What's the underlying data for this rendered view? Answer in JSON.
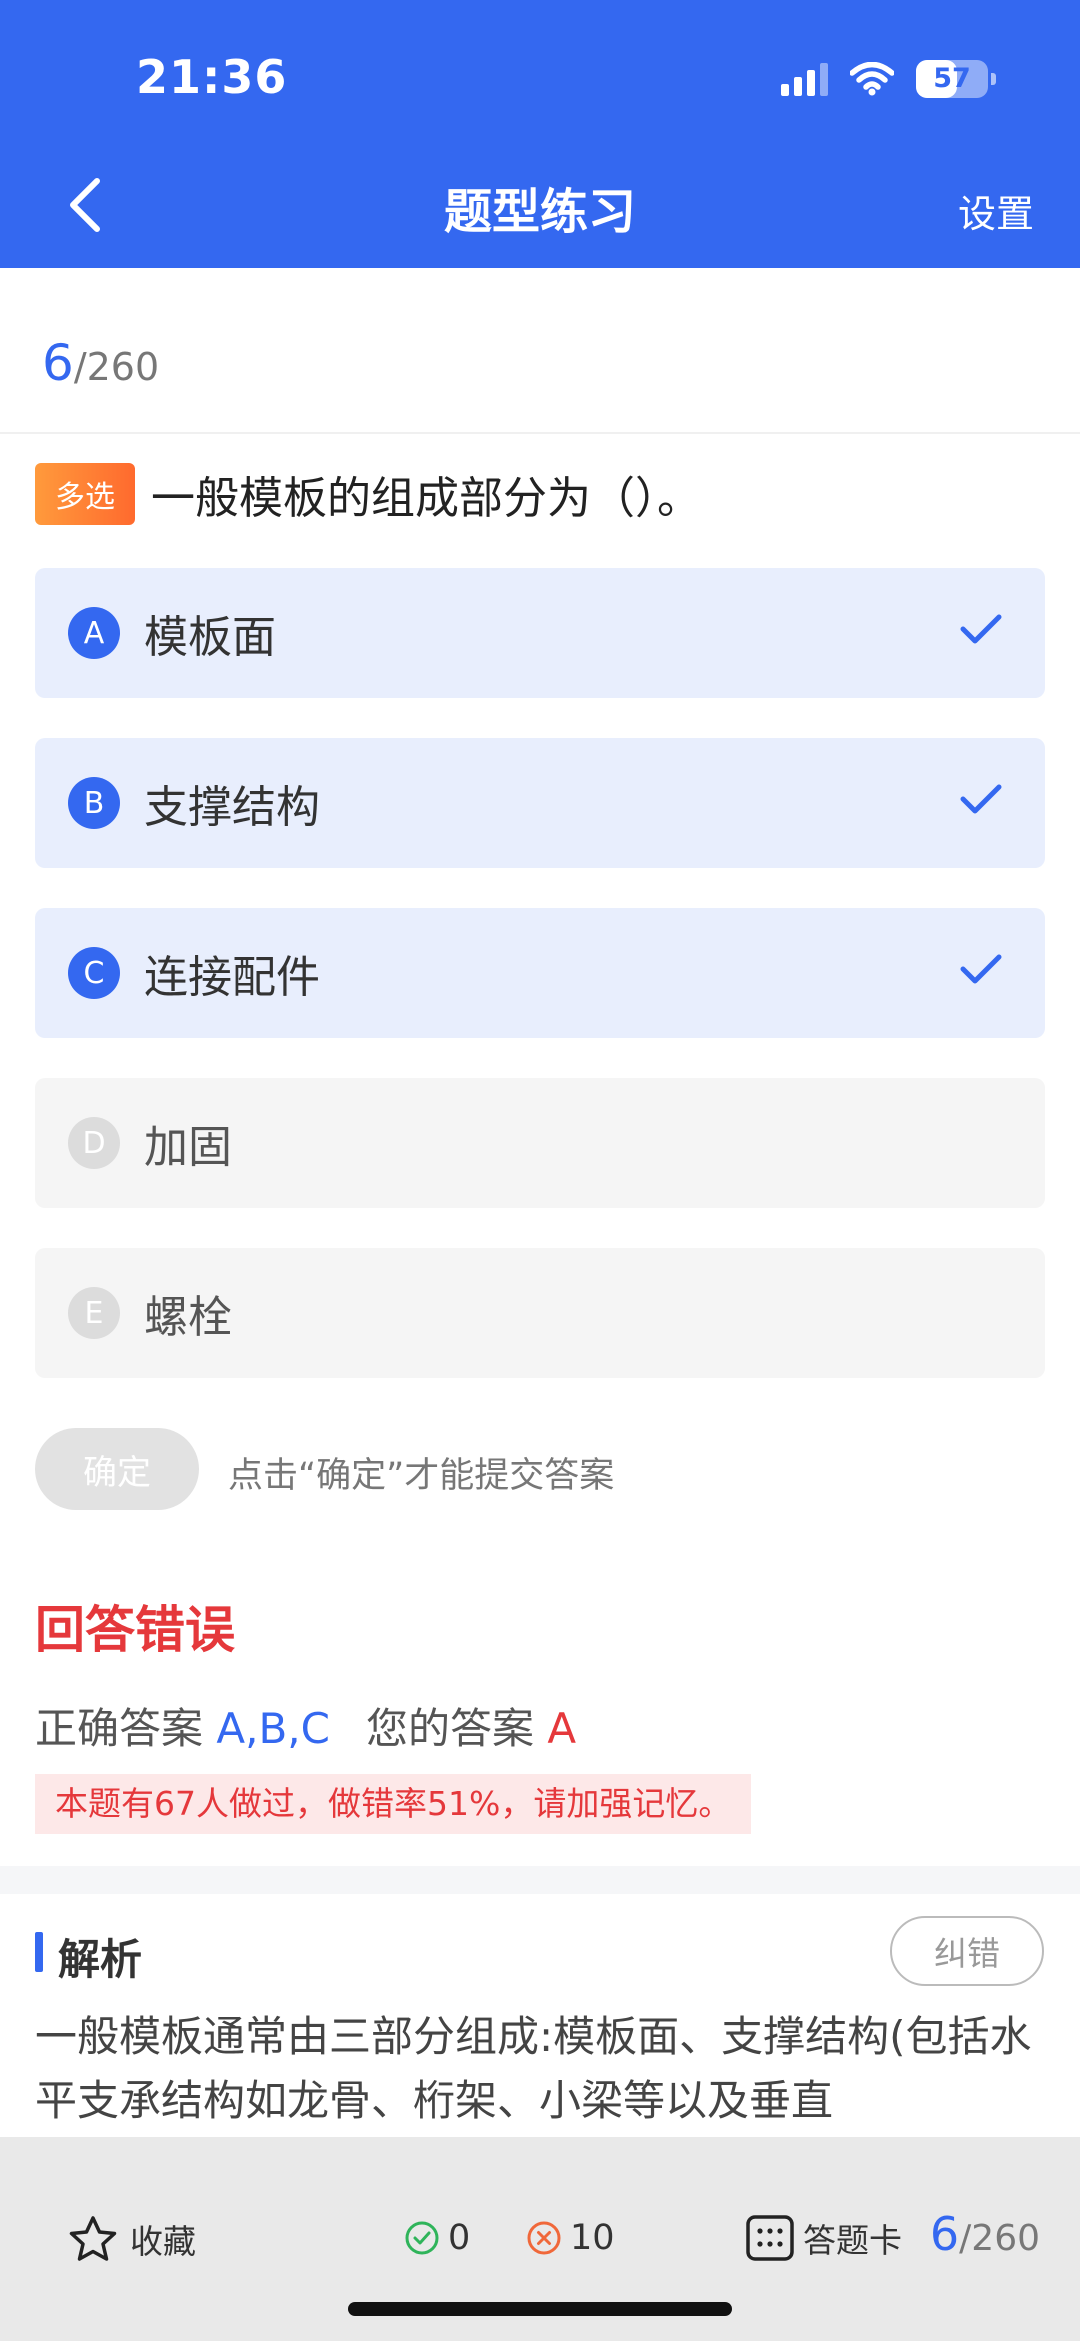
{
  "status_bar": {
    "time": "21:36",
    "battery": "57",
    "battery_level": 0.57
  },
  "nav": {
    "title": "题型练习",
    "settings_label": "设置"
  },
  "progress": {
    "current": "6",
    "total": "/260"
  },
  "question": {
    "type_badge": "多选",
    "text": "一般模板的组成部分为（）。",
    "options": [
      {
        "letter": "A",
        "text": "模板面",
        "selected": true
      },
      {
        "letter": "B",
        "text": "支撑结构",
        "selected": true
      },
      {
        "letter": "C",
        "text": "连接配件",
        "selected": true
      },
      {
        "letter": "D",
        "text": "加固",
        "selected": false
      },
      {
        "letter": "E",
        "text": "螺栓",
        "selected": false
      }
    ]
  },
  "submit": {
    "button_label": "确定",
    "hint": "点击“确定”才能提交答案"
  },
  "result": {
    "title": "回答错误",
    "correct_label": "正确答案",
    "correct_value": "A,B,C",
    "your_label": "您的答案",
    "your_value": "A",
    "stat_note": "本题有67人做过，做错率51%，请加强记忆。"
  },
  "analysis": {
    "title": "解析",
    "report_label": "纠错",
    "text": "一般模板通常由三部分组成:模板面、支撑结构(包括水平支承结构如龙骨、桁架、小梁等以及垂直"
  },
  "bottom_bar": {
    "favorite_label": "收藏",
    "correct_count": "0",
    "wrong_count": "10",
    "answer_card_label": "答题卡",
    "progress_current": "6",
    "progress_total": "/260"
  },
  "colors": {
    "primary": "#3468f0",
    "error": "#e5383b",
    "badge": "#ff7a30",
    "correct": "#2fb45a"
  }
}
